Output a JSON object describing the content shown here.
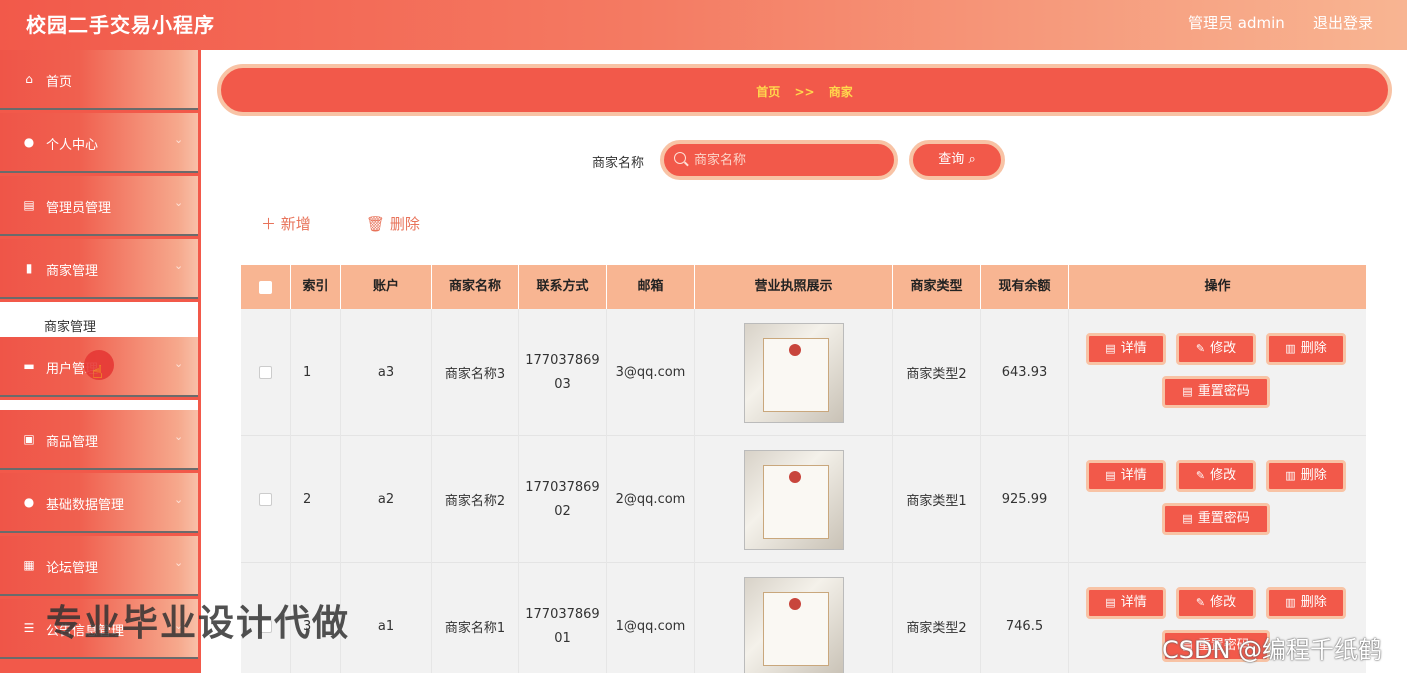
{
  "header": {
    "title": "校园二手交易小程序",
    "admin": "管理员 admin",
    "logout": "退出登录"
  },
  "sidebar": {
    "items": [
      {
        "label": "首页",
        "icon": "home-icon",
        "glyph": "⌂"
      },
      {
        "label": "个人中心",
        "icon": "user-icon",
        "glyph": "●"
      },
      {
        "label": "管理员管理",
        "icon": "clipboard-icon",
        "glyph": "▤"
      },
      {
        "label": "商家管理",
        "icon": "bar-chart-icon",
        "glyph": "▮"
      },
      {
        "label": "用户管理",
        "icon": "briefcase-icon",
        "glyph": "▬"
      },
      {
        "label": "商品管理",
        "icon": "shopping-bag-icon",
        "glyph": "▣"
      },
      {
        "label": "基础数据管理",
        "icon": "location-pin-icon",
        "glyph": "●"
      },
      {
        "label": "论坛管理",
        "icon": "grid-icon",
        "glyph": "▦"
      },
      {
        "label": "公告信息管理",
        "icon": "sliders-icon",
        "glyph": "☰"
      }
    ],
    "active_submenu": "商家管理"
  },
  "breadcrumb": {
    "home": "首页",
    "sep": ">>",
    "current": "商家"
  },
  "search": {
    "label": "商家名称",
    "placeholder": "商家名称",
    "button": "查询"
  },
  "toolbar": {
    "add": "新增",
    "delete": "删除"
  },
  "table": {
    "headers": [
      "索引",
      "账户",
      "商家名称",
      "联系方式",
      "邮箱",
      "营业执照展示",
      "商家类型",
      "现有余额",
      "操作"
    ],
    "rows": [
      {
        "index": "1",
        "account": "a3",
        "name": "商家名称3",
        "phone": "17703786903",
        "email": "3@qq.com",
        "type": "商家类型2",
        "balance": "643.93"
      },
      {
        "index": "2",
        "account": "a2",
        "name": "商家名称2",
        "phone": "17703786902",
        "email": "2@qq.com",
        "type": "商家类型1",
        "balance": "925.99"
      },
      {
        "index": "3",
        "account": "a1",
        "name": "商家名称1",
        "phone": "17703786901",
        "email": "1@qq.com",
        "type": "商家类型2",
        "balance": "746.5"
      }
    ],
    "actions": {
      "detail": "详情",
      "edit": "修改",
      "delete": "删除",
      "reset": "重置密码"
    }
  },
  "overlay": {
    "watermark": "专业毕业设计代做",
    "csdn": "CSDN @编程千纸鹤"
  },
  "colors": {
    "primary": "#f2594a",
    "accent_border": "#f8c3a5",
    "header_row": "#f8b592",
    "breadcrumb_text": "#ffd84d"
  }
}
